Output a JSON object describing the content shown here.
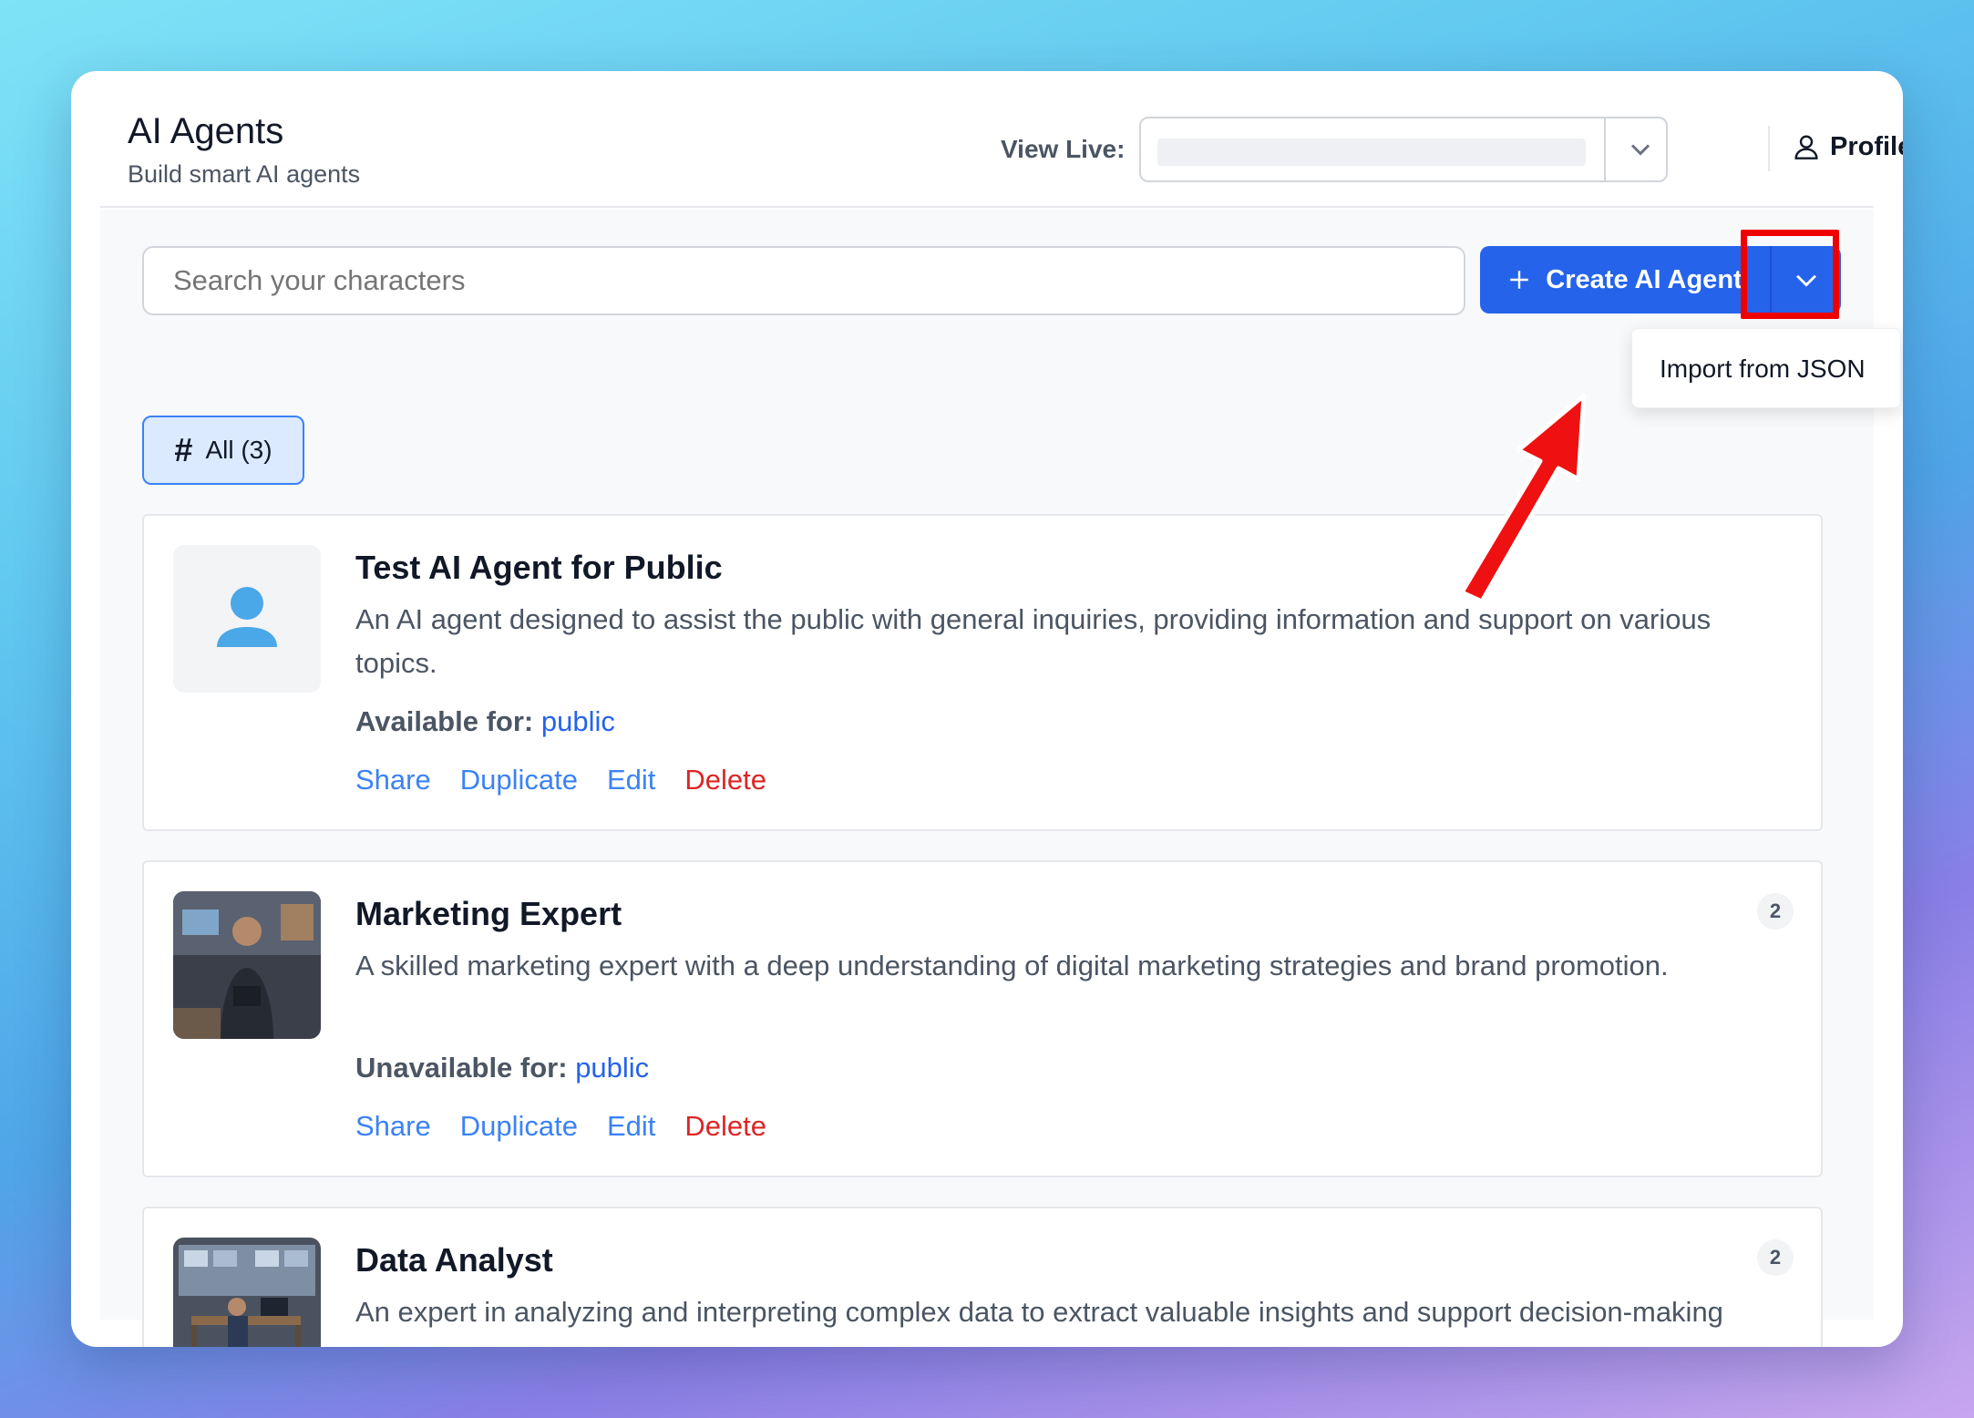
{
  "header": {
    "title": "AI Agents",
    "subtitle": "Build smart AI agents",
    "view_live_label": "View Live:",
    "profile_label": "Profile"
  },
  "toolbar": {
    "search_placeholder": "Search your characters",
    "create_label": "Create AI Agent",
    "dropdown_item": "Import from JSON"
  },
  "filter": {
    "all_label": "All (3)"
  },
  "agents": [
    {
      "name": "Test AI Agent for Public",
      "description": "An AI agent designed to assist the public with general inquiries, providing information and support on various topics.",
      "availability_label": "Available for:",
      "availability_value": "public",
      "badge": "",
      "actions": [
        "Share",
        "Duplicate",
        "Edit",
        "Delete"
      ]
    },
    {
      "name": "Marketing Expert",
      "description": "A skilled marketing expert with a deep understanding of digital marketing strategies and brand promotion.",
      "availability_label": "Unavailable for:",
      "availability_value": "public",
      "badge": "2",
      "actions": [
        "Share",
        "Duplicate",
        "Edit",
        "Delete"
      ]
    },
    {
      "name": "Data Analyst",
      "description": "An expert in analyzing and interpreting complex data to extract valuable insights and support decision-making processes.",
      "badge": "2"
    }
  ],
  "colors": {
    "accent": "#2563eb",
    "danger": "#dc2626",
    "highlight": "#ef0000"
  }
}
